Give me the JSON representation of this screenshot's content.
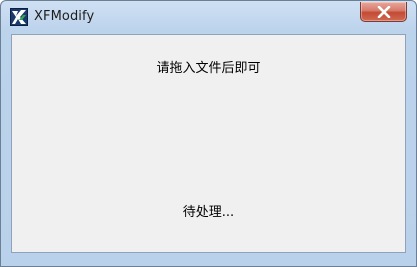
{
  "window": {
    "title": "XFModify",
    "app_icon": "xfmodify-app-icon",
    "close_icon": "close-icon",
    "accent_close": "#c44a35",
    "frame_color": "#b9d1ea"
  },
  "content": {
    "instruction": "请拖入文件后即可",
    "status": "待处理..."
  }
}
